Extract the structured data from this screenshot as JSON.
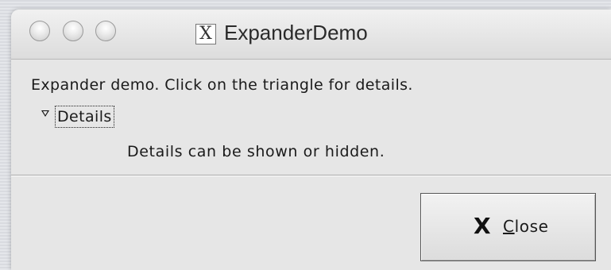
{
  "window": {
    "title": "ExpanderDemo",
    "app_icon_glyph": "X",
    "controls": [
      "close-traffic-light",
      "minimize-traffic-light",
      "zoom-traffic-light"
    ]
  },
  "content": {
    "instruction": "Expander demo. Click on the triangle for details.",
    "expander": {
      "label": "Details",
      "expanded": true,
      "body": "Details can be shown or hidden."
    }
  },
  "buttons": {
    "close": {
      "icon": "x-icon",
      "icon_glyph": "X",
      "mnemonic": "C",
      "label_rest": "lose"
    }
  }
}
